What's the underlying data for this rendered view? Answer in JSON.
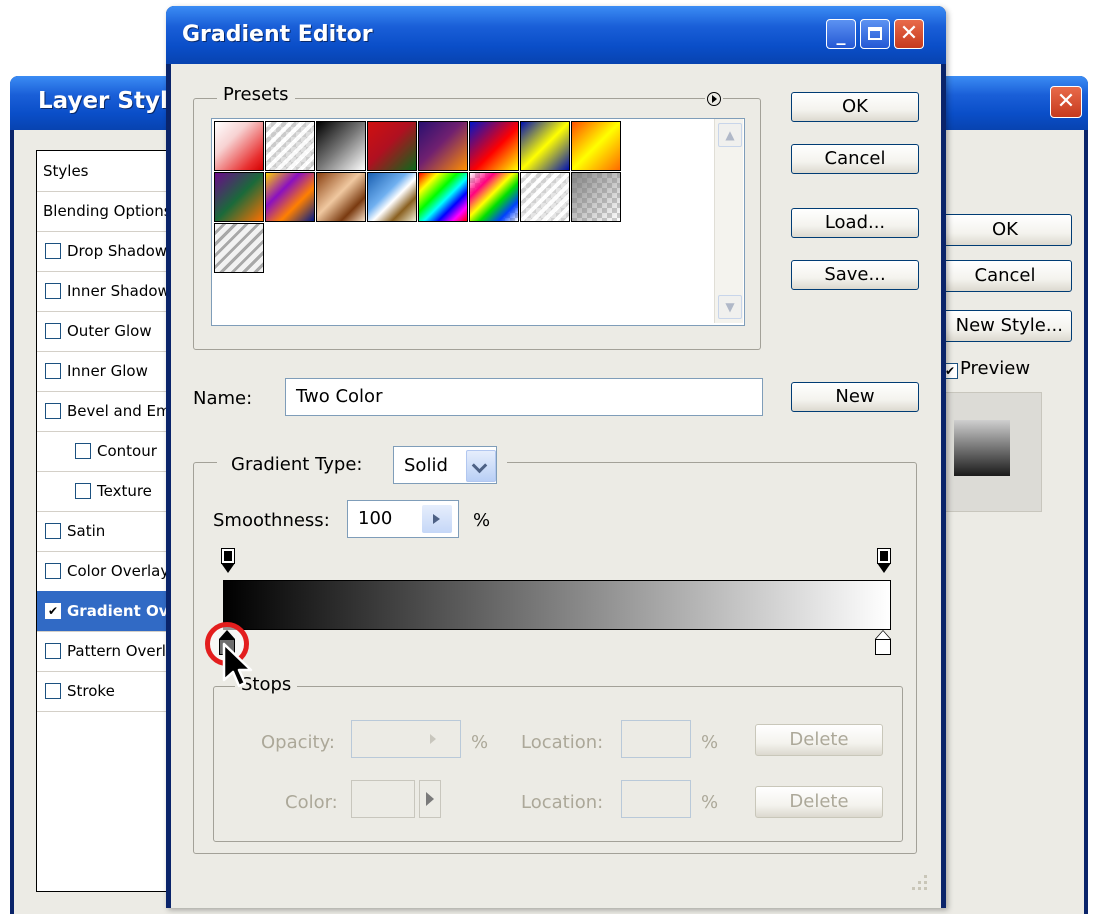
{
  "layer_style": {
    "title": "Layer Style",
    "styles_items": [
      {
        "label": "Styles",
        "checkbox": false,
        "indent": false
      },
      {
        "label": "Blending Options: Default",
        "checkbox": false,
        "indent": false
      },
      {
        "label": "Drop Shadow",
        "checkbox": true,
        "checked": false,
        "indent": false
      },
      {
        "label": "Inner Shadow",
        "checkbox": true,
        "checked": false,
        "indent": false
      },
      {
        "label": "Outer Glow",
        "checkbox": true,
        "checked": false,
        "indent": false
      },
      {
        "label": "Inner Glow",
        "checkbox": true,
        "checked": false,
        "indent": false
      },
      {
        "label": "Bevel and Emboss",
        "checkbox": true,
        "checked": false,
        "indent": false
      },
      {
        "label": "Contour",
        "checkbox": true,
        "checked": false,
        "indent": true
      },
      {
        "label": "Texture",
        "checkbox": true,
        "checked": false,
        "indent": true
      },
      {
        "label": "Satin",
        "checkbox": true,
        "checked": false,
        "indent": false
      },
      {
        "label": "Color Overlay",
        "checkbox": true,
        "checked": false,
        "indent": false
      },
      {
        "label": "Gradient Overlay",
        "checkbox": true,
        "checked": true,
        "indent": false,
        "selected": true
      },
      {
        "label": "Pattern Overlay",
        "checkbox": true,
        "checked": false,
        "indent": false
      },
      {
        "label": "Stroke",
        "checkbox": true,
        "checked": false,
        "indent": false
      }
    ],
    "ok_label": "OK",
    "cancel_label": "Cancel",
    "new_style_label": "New Style...",
    "preview_label": "Preview",
    "preview_checked": true
  },
  "gradient_editor": {
    "title": "Gradient Editor",
    "presets_label": "Presets",
    "presets": [
      "red-transparent",
      "transparent-stripes",
      "black-white",
      "red-green",
      "violet-orange",
      "blue-red-yellow",
      "blue-yellow-blue",
      "orange-yellow-orange",
      "violet-green-orange",
      "yellow-violet-orange-blue",
      "copper",
      "chrome",
      "spectrum",
      "transparent-rainbow",
      "transparent-stripes-2",
      "checker-transparent",
      "gray-stripes"
    ],
    "ok_label": "OK",
    "cancel_label": "Cancel",
    "load_label": "Load...",
    "save_label": "Save...",
    "name_label": "Name:",
    "name_value": "Two Color",
    "new_label": "New",
    "gradient_type_label": "Gradient Type:",
    "gradient_type_value": "Solid",
    "smoothness_label": "Smoothness:",
    "smoothness_value": "100",
    "percent": "%",
    "stops_label": "Stops",
    "opacity_label": "Opacity:",
    "color_label": "Color:",
    "location_label": "Location:",
    "delete_label": "Delete"
  },
  "colors": {
    "titlebar": "#0a4ec8",
    "dialog_bg": "#ecebe5",
    "selection": "#316ac5",
    "highlight_ring": "#e31e1e"
  }
}
